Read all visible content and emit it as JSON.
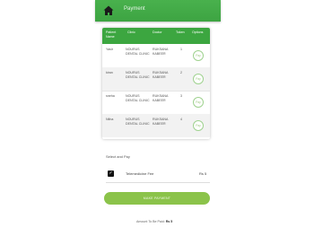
{
  "app_bar": {
    "title": "Payment",
    "home_icon": "home-icon",
    "color": "#3da442"
  },
  "table": {
    "headers": [
      "Patient Name",
      "Clinic",
      "Doctor",
      "Token",
      "Options"
    ],
    "rows": [
      {
        "patient": "Yasir",
        "clinic": "NOURUS DENTAL CLINIC",
        "doctor": "RUKSANA KABEER",
        "token": "1",
        "option": "Pay"
      },
      {
        "patient": "kiran",
        "clinic": "NOURUS DENTAL CLINIC",
        "doctor": "RUKSANA KABEER",
        "token": "2",
        "option": "Pay"
      },
      {
        "patient": "sneha",
        "clinic": "NOURUS DENTAL CLINIC",
        "doctor": "RUKSANA KABEER",
        "token": "3",
        "option": "Pay"
      },
      {
        "patient": "Nitha",
        "clinic": "NOURUS DENTAL CLINIC",
        "doctor": "RUKSANA KABEER",
        "token": "4",
        "option": "Pay"
      }
    ]
  },
  "payment": {
    "select_label": "Select and Pay",
    "item_label": "Telemedicine Fee",
    "item_amount": "Rs 5",
    "item_checked": true,
    "button_label": "MAKE PAYMENT",
    "amount_label": "Amount To Be Paid:",
    "amount_value": "Rs 5"
  },
  "colors": {
    "header_green": "#3ca640",
    "button_green": "#8bc34a"
  }
}
